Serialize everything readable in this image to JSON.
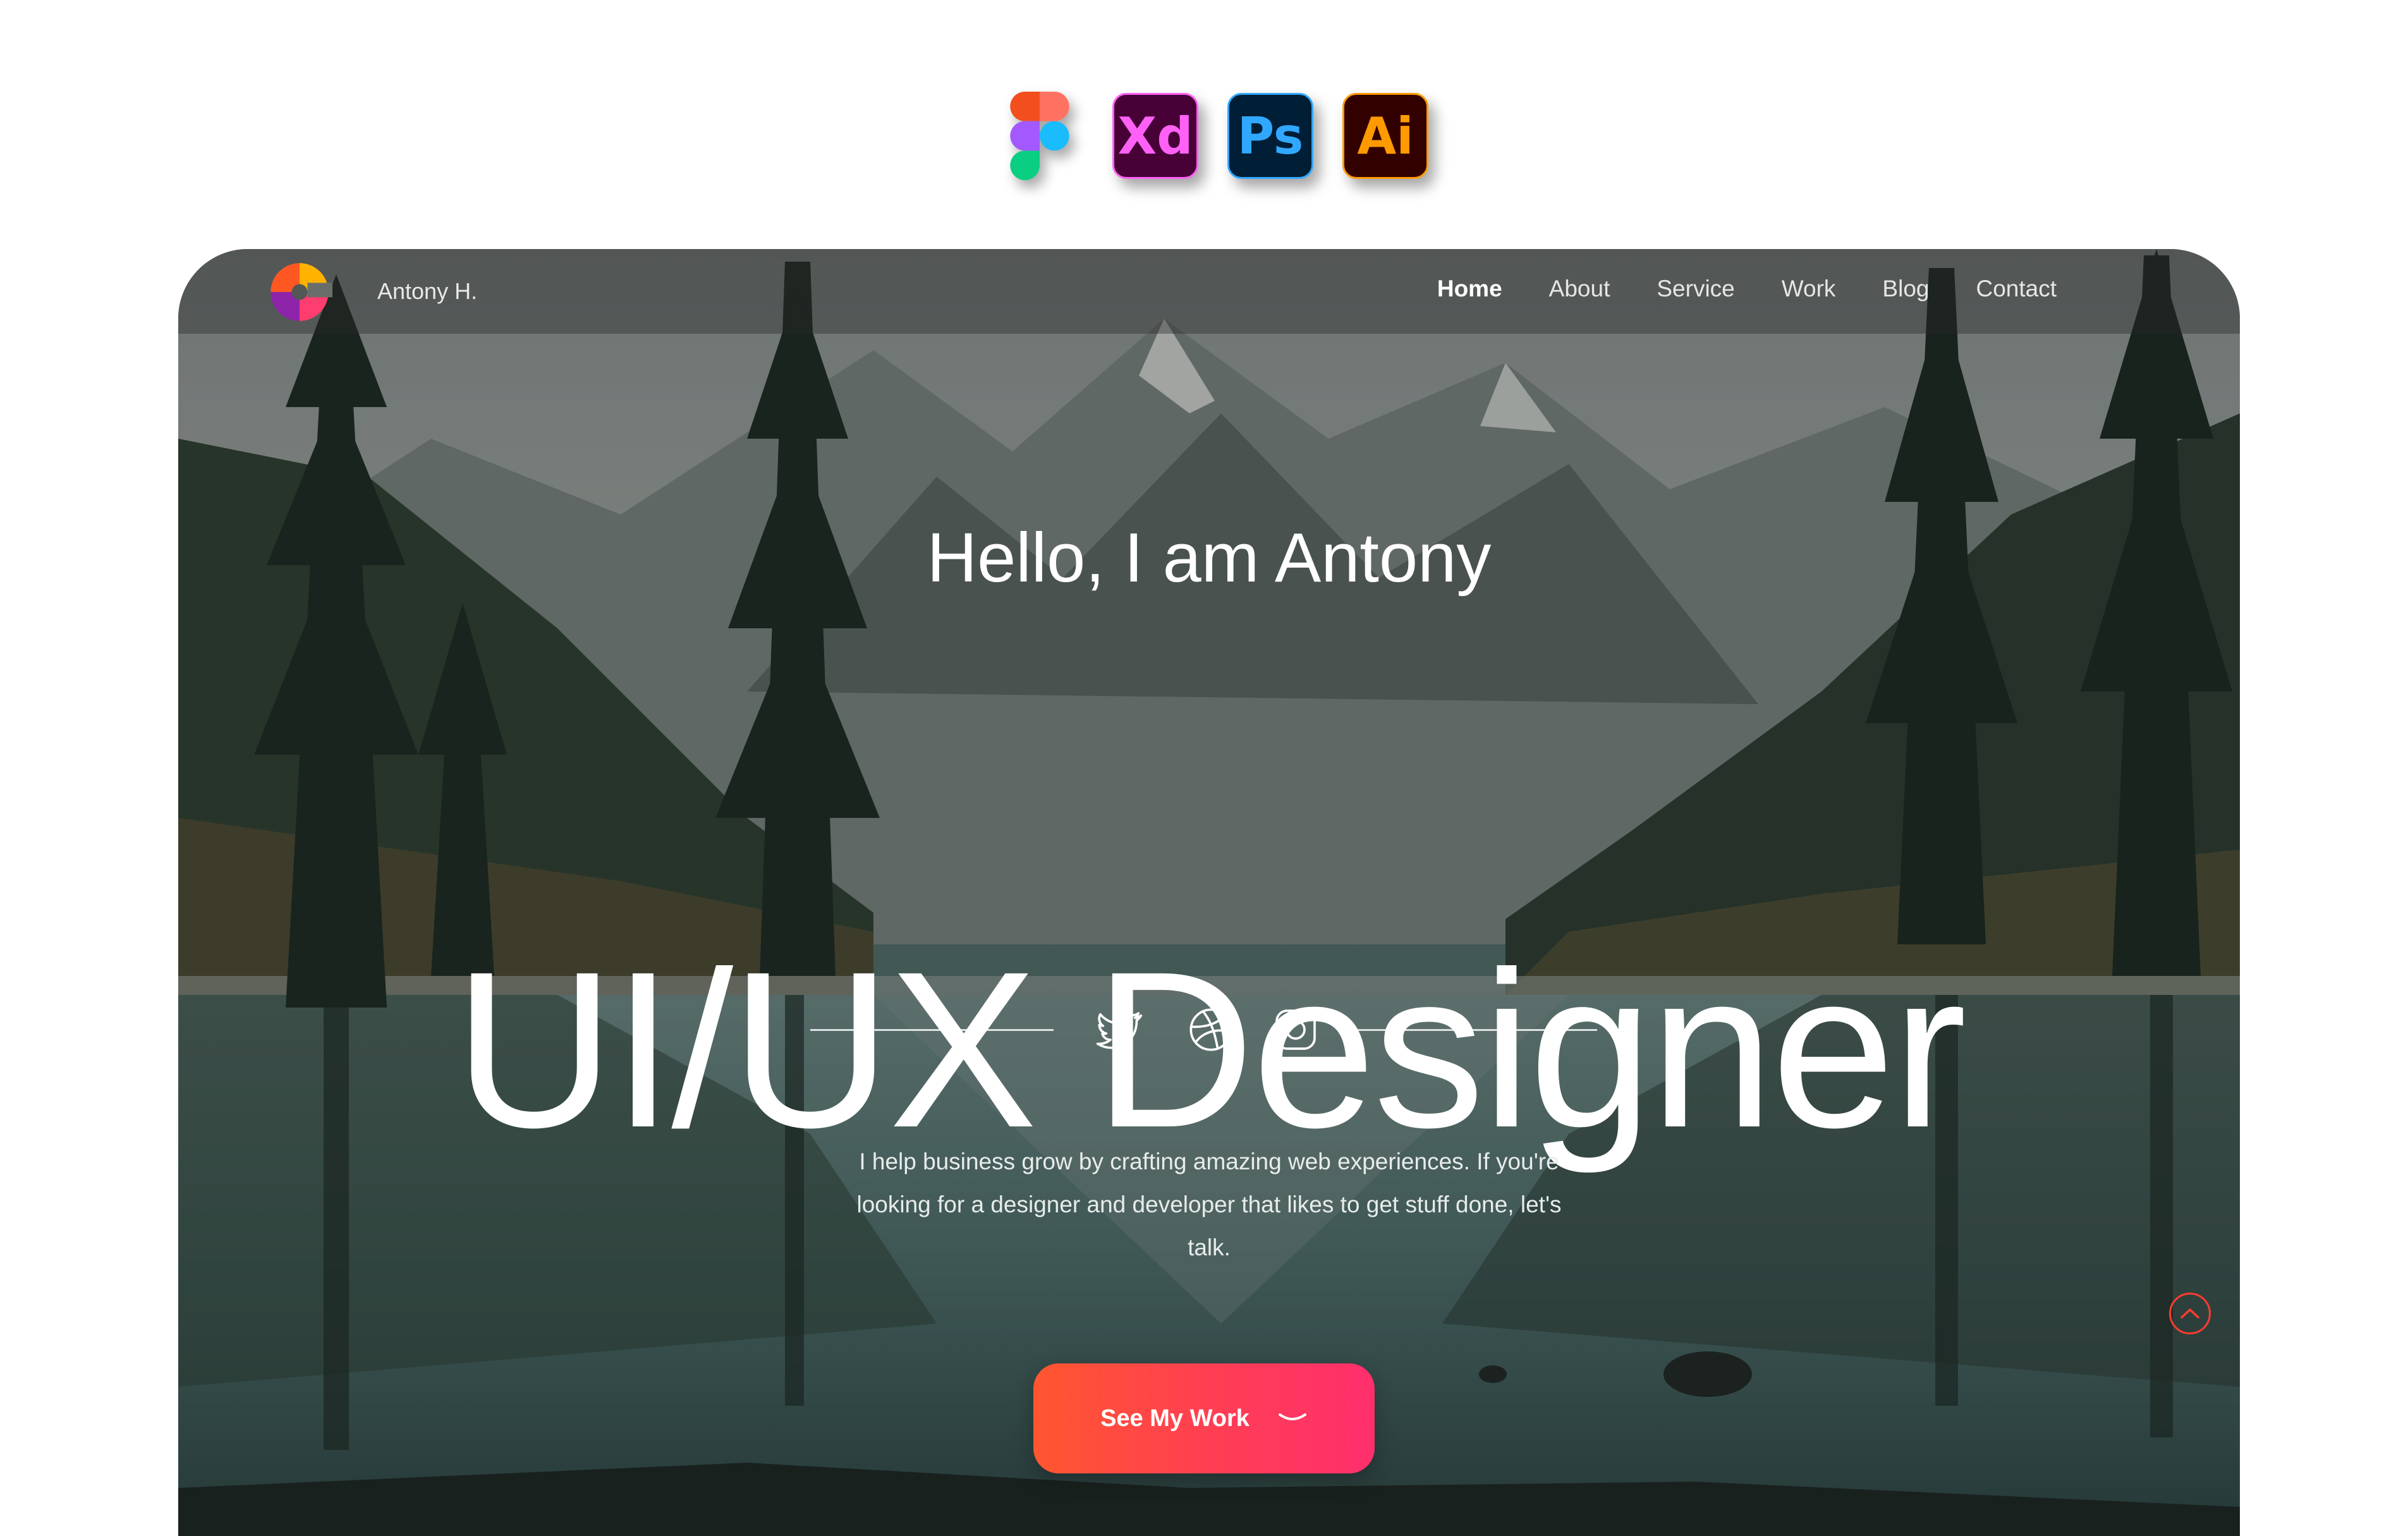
{
  "tools": [
    {
      "name": "figma-icon",
      "label": ""
    },
    {
      "name": "adobe-xd-icon",
      "label": "Xd"
    },
    {
      "name": "photoshop-icon",
      "label": "Ps"
    },
    {
      "name": "illustrator-icon",
      "label": "Ai"
    }
  ],
  "header": {
    "brand": "Antony H.",
    "nav": [
      "Home",
      "About",
      "Service",
      "Work",
      "Blog",
      "Contact"
    ],
    "active": "Home"
  },
  "hero": {
    "greeting": "Hello, I am Antony",
    "headline": "UI/UX Designer",
    "social": [
      "twitter-icon",
      "dribbble-icon",
      "instagram-icon"
    ],
    "bio": "I help business grow by crafting amazing web experiences. If you're looking for a designer and developer that likes to get stuff done, let's talk.",
    "cta_label": "See My Work"
  },
  "colors": {
    "accent_start": "#ff5630",
    "accent_end": "#ff2f6d",
    "scroll_top_ring": "#ff3b30"
  }
}
